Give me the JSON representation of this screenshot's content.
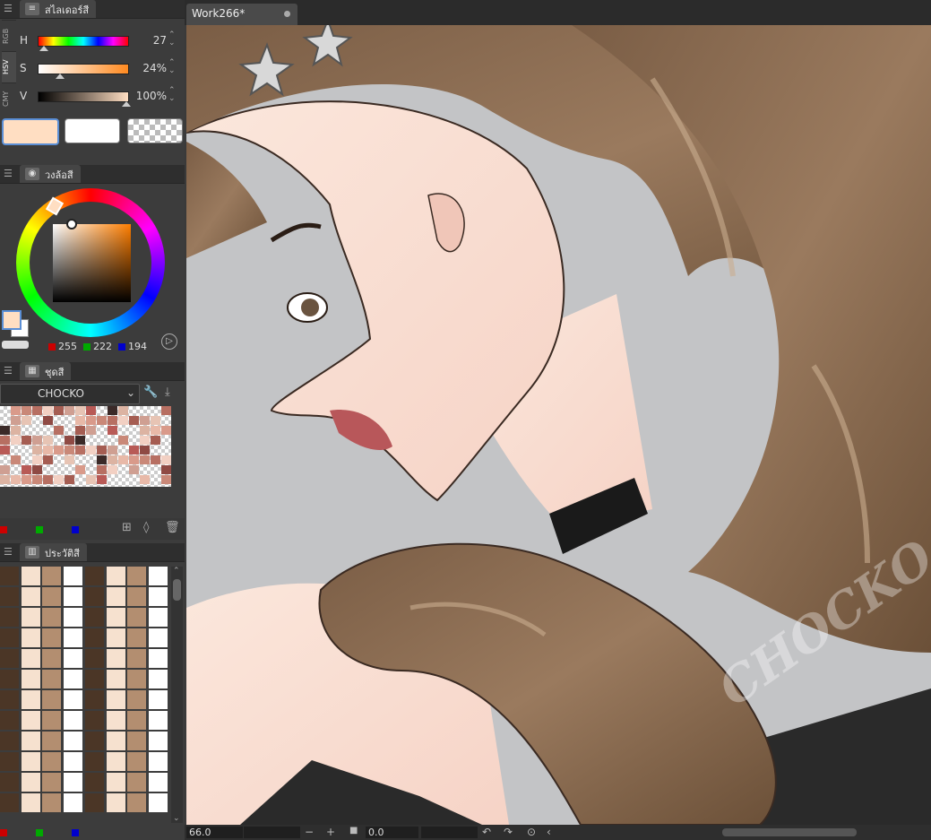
{
  "colors": {
    "accent_hsv": "#ffdec2",
    "canvas_bg": "#c3c4c6"
  },
  "slider_panel": {
    "tab_label": "สไลเดอร์สี",
    "modes": [
      "RGB",
      "HSV",
      "CMY"
    ],
    "active_mode": "HSV",
    "h": {
      "label": "H",
      "value": "27"
    },
    "s": {
      "label": "S",
      "value": "24%"
    },
    "v": {
      "label": "V",
      "value": "100%"
    }
  },
  "wheel_panel": {
    "tab_label": "วงล้อสี",
    "rgb": {
      "r": "255",
      "g": "222",
      "b": "194"
    }
  },
  "colorset_panel": {
    "tab_label": "ชุดสี",
    "set_name": "CHOCKO"
  },
  "history_panel": {
    "tab_label": "ประวัติสี"
  },
  "document": {
    "tab_title": "Work266*"
  },
  "status": {
    "zoom": "66.0",
    "rotation": "0.0"
  },
  "watermark": "CHOCKO"
}
